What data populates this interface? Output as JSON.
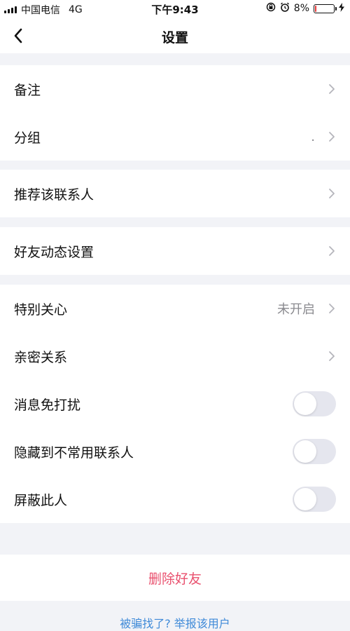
{
  "status_bar": {
    "carrier": "中国电信",
    "network": "4G",
    "time": "下午9:43",
    "battery": "8%",
    "battery_level": 0.08,
    "battery_color": "#e83a3a"
  },
  "nav": {
    "title": "设置"
  },
  "groups": {
    "g1": {
      "remark": {
        "label": "备注"
      },
      "group": {
        "label": "分组",
        "value": "."
      }
    },
    "g2": {
      "recommend": {
        "label": "推荐该联系人"
      }
    },
    "g3": {
      "moments": {
        "label": "好友动态设置"
      }
    },
    "g4": {
      "special_care": {
        "label": "特别关心",
        "value": "未开启"
      },
      "intimate": {
        "label": "亲密关系"
      },
      "dnd": {
        "label": "消息免打扰",
        "on": false
      },
      "hide": {
        "label": "隐藏到不常用联系人",
        "on": false
      },
      "block": {
        "label": "屏蔽此人",
        "on": false
      }
    }
  },
  "delete_button": "删除好友",
  "report_link": "被骗找了? 举报该用户",
  "colors": {
    "accent_red": "#e9506e",
    "link_blue": "#3f8ad8",
    "background": "#f2f3f7"
  }
}
